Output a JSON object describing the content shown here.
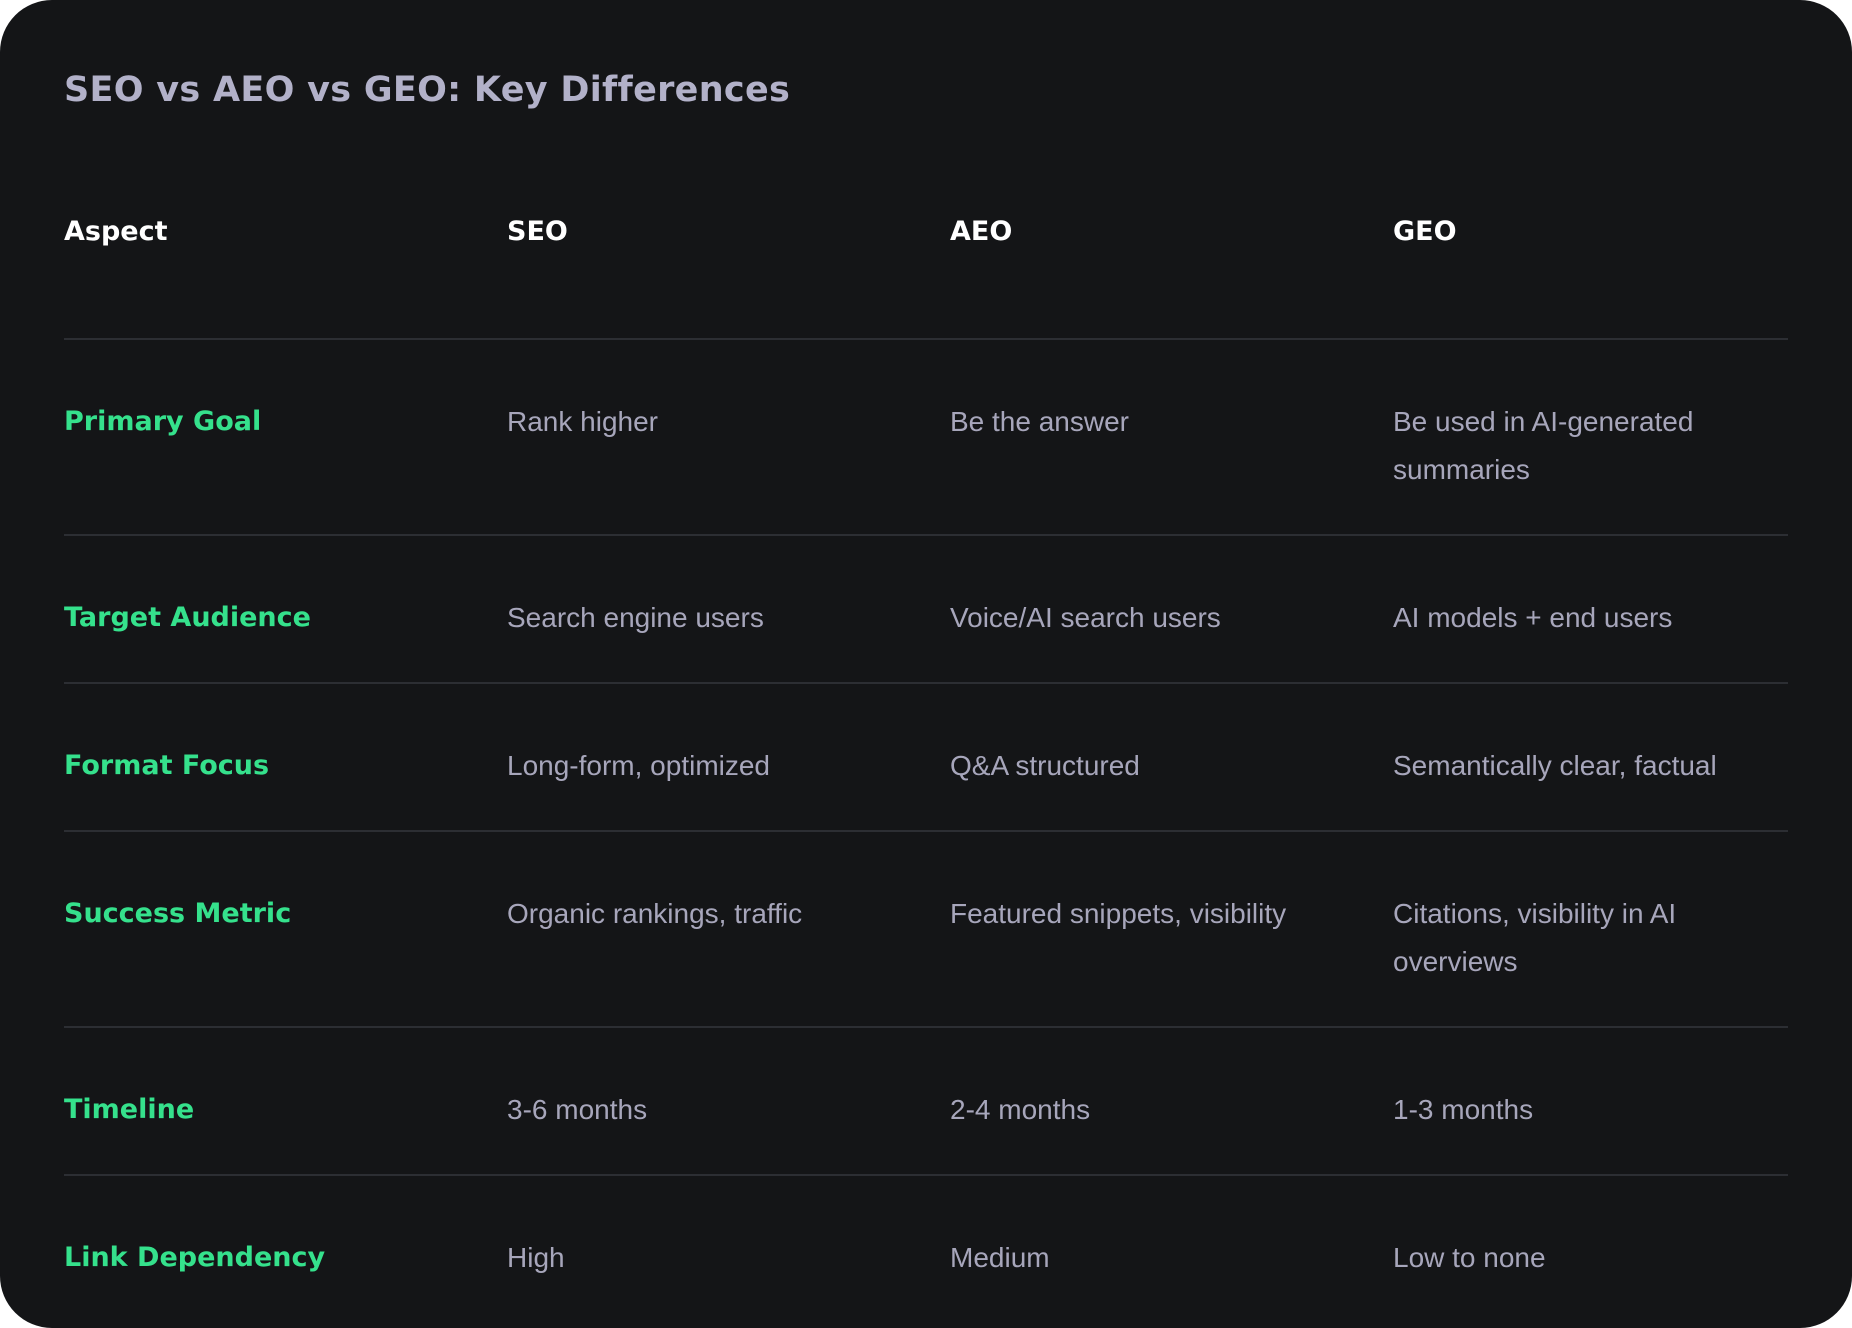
{
  "title": "SEO vs AEO vs GEO: Key Differences",
  "colors": {
    "background": "#141517",
    "title": "#b2b1c9",
    "header": "#ffffff",
    "aspect": "#35e18c",
    "cell": "#a7a6bb",
    "divider": "#2c2e33"
  },
  "table": {
    "headers": [
      "Aspect",
      "SEO",
      "AEO",
      "GEO"
    ],
    "rows": [
      {
        "aspect": "Primary Goal",
        "seo": "Rank higher",
        "aeo": "Be the answer",
        "geo": "Be used in AI-generated summaries"
      },
      {
        "aspect": "Target Audience",
        "seo": "Search engine users",
        "aeo": "Voice/AI search users",
        "geo": "AI models + end users"
      },
      {
        "aspect": "Format Focus",
        "seo": "Long-form, optimized",
        "aeo": "Q&A structured",
        "geo": "Semantically clear, factual"
      },
      {
        "aspect": "Success Metric",
        "seo": "Organic rankings, traffic",
        "aeo": "Featured snippets, visibility",
        "geo": "Citations, visibility in AI overviews"
      },
      {
        "aspect": "Timeline",
        "seo": "3-6 months",
        "aeo": "2-4 months",
        "geo": "1-3 months"
      },
      {
        "aspect": "Link Dependency",
        "seo": "High",
        "aeo": "Medium",
        "geo": "Low to none"
      }
    ]
  }
}
